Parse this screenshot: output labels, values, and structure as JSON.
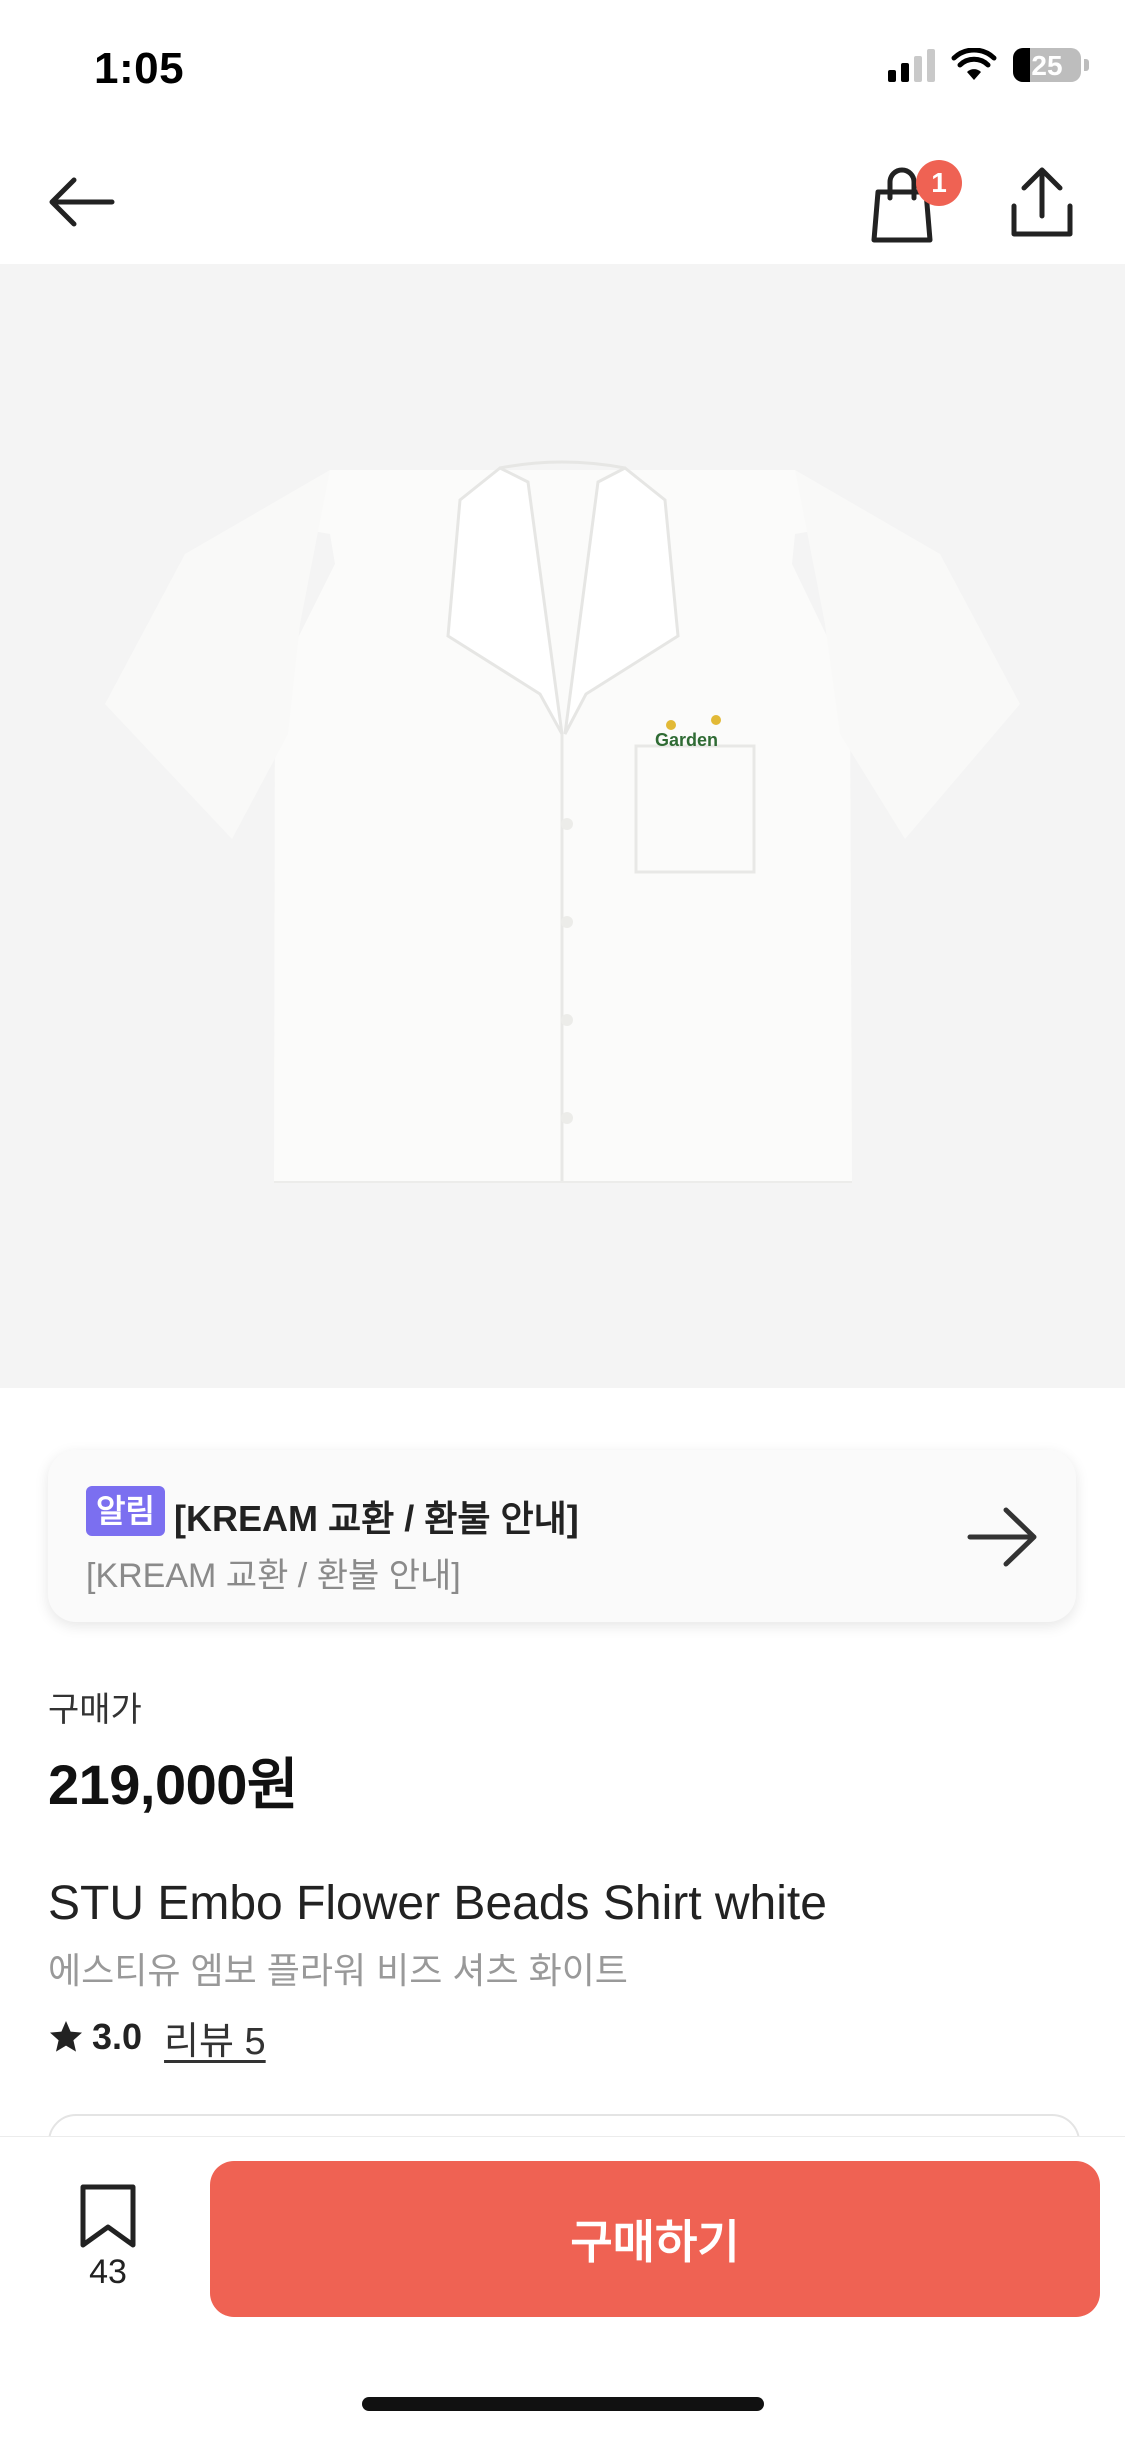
{
  "status_bar": {
    "time": "1:05",
    "battery_level": "25",
    "icons": [
      "signal-icon",
      "wifi-icon",
      "battery-icon"
    ]
  },
  "nav": {
    "icons": [
      "back-arrow-icon",
      "shopping-bag-icon",
      "share-icon"
    ],
    "cart_count": "1"
  },
  "product_image": {
    "alt": "white short-sleeve shirt with Garden embroidery"
  },
  "notice": {
    "badge": "알림",
    "title": "[KREAM 교환 / 환불 안내]",
    "subtitle": "[KREAM 교환 / 환불 안내]",
    "icon": "arrow-right-icon"
  },
  "price": {
    "label": "구매가",
    "value": "219,000원"
  },
  "product": {
    "name_en": "STU Embo Flower Beads Shirt white",
    "name_ko": "에스티유 엠보 플라워 비즈 셔츠 화이트",
    "rating": "3.0",
    "review_link": "리뷰 5"
  },
  "bottom_bar": {
    "bookmark_count": "43",
    "buy_label": "구매하기"
  },
  "colors": {
    "accent": "#ef6253",
    "badge": "#7b6ff0",
    "image_bg": "#f4f4f4"
  }
}
